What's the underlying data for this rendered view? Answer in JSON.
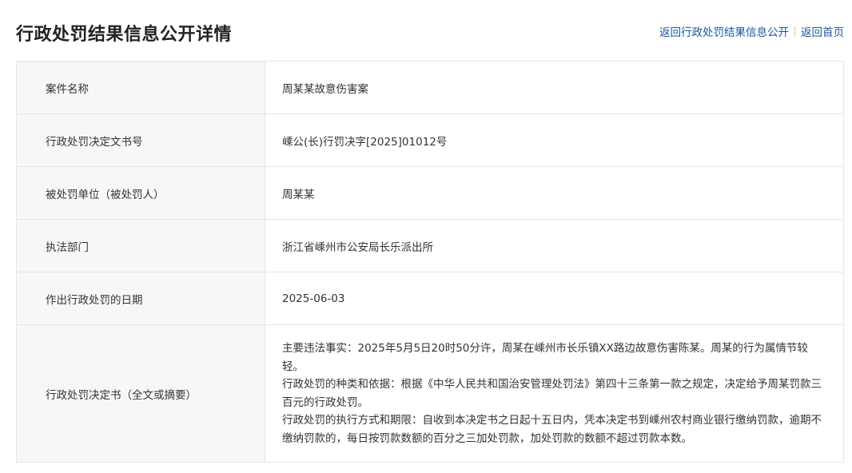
{
  "page": {
    "title": "行政处罚结果信息公开详情",
    "links": {
      "back_list": "返回行政处罚结果信息公开",
      "back_home": "返回首页"
    }
  },
  "details": {
    "rows": [
      {
        "label": "案件名称",
        "value": "周某某故意伤害案"
      },
      {
        "label": "行政处罚决定文书号",
        "value": "嵊公(长)行罚决字[2025]01012号"
      },
      {
        "label": "被处罚单位（被处罚人）",
        "value": "周某某"
      },
      {
        "label": "执法部门",
        "value": "浙江省嵊州市公安局长乐派出所"
      },
      {
        "label": "作出行政处罚的日期",
        "value": "2025-06-03"
      }
    ],
    "decision": {
      "label": "行政处罚决定书（全文或摘要）",
      "paragraphs": [
        "主要违法事实：2025年5月5日20时50分许，周某在嵊州市长乐镇XX路边故意伤害陈某。周某的行为属情节较轻。",
        "行政处罚的种类和依据：根据《中华人民共和国治安管理处罚法》第四十三条第一款之规定，决定给予周某罚款三百元的行政处罚。",
        "行政处罚的执行方式和期限：自收到本决定书之日起十五日内，凭本决定书到嵊州农村商业银行缴纳罚款，逾期不缴纳罚款的，每日按罚款数额的百分之三加处罚款，加处罚款的数额不超过罚款本数。"
      ]
    }
  }
}
